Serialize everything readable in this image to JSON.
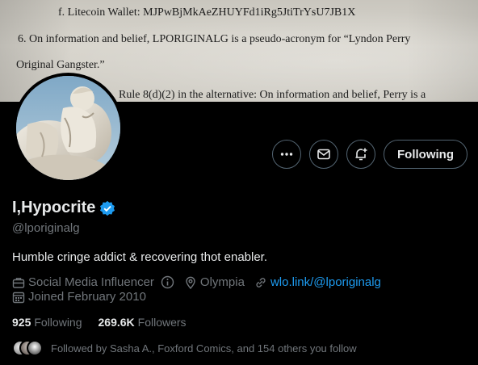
{
  "banner": {
    "lines": [
      "f.        Litecoin Wallet: MJPwBjMkAeZHUYFd1iRg5JtiTrYsU7JB1X",
      "6.      On information and belief, LPORIGINALG is a pseudo-acronym for “Lyndon Perry",
      "Original Gangster.”",
      "Rule 8(d)(2) in the alternative: On information and belief, Perry is a"
    ]
  },
  "profile": {
    "name": "I,Hypocrite",
    "handle": "@lporiginalg",
    "bio": "Humble cringe addict & recovering thot enabler.",
    "category": "Social Media Influencer",
    "location": "Olympia",
    "link": "wlo.link/@lporiginalg",
    "joined": "Joined February 2010",
    "following_count": "925",
    "following_label": "Following",
    "followers_count": "269.6K",
    "followers_label": "Followers",
    "followed_by": "Followed by Sasha A., Foxford Comics, and 154 others you follow",
    "verified_color": "#1d9bf0"
  },
  "actions": {
    "more_icon": "more-icon",
    "message_icon": "envelope-icon",
    "notify_icon": "bell-plus-icon",
    "follow_label": "Following"
  }
}
